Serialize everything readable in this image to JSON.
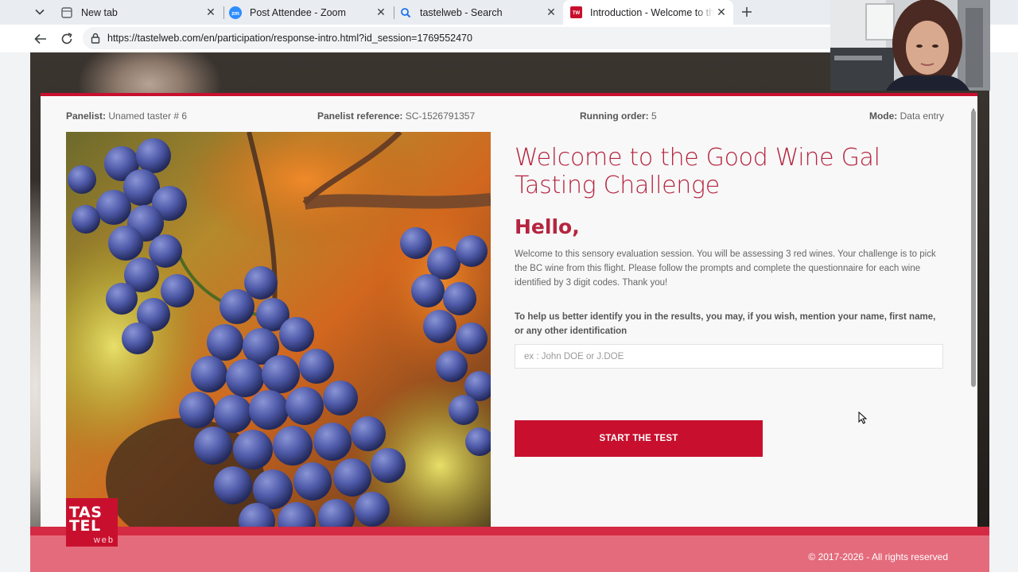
{
  "tabs": [
    {
      "title": "New tab",
      "favicon": "new-tab-page-icon"
    },
    {
      "title": "Post Attendee - Zoom",
      "favicon": "zoom-icon"
    },
    {
      "title": "tastelweb - Search",
      "favicon": "search-icon"
    },
    {
      "title": "Introduction - Welcome to the Go",
      "favicon": "tastelweb-favicon",
      "active": true
    }
  ],
  "address_bar": {
    "url": "https://tastelweb.com/en/participation/response-intro.html?id_session=1769552470"
  },
  "panel_info": {
    "panelist_label": "Panelist:",
    "panelist_value": "Unamed taster # 6",
    "reference_label": "Panelist reference:",
    "reference_value": "SC-1526791357",
    "order_label": "Running order:",
    "order_value": "5",
    "mode_label": "Mode:",
    "mode_value": "Data entry"
  },
  "content": {
    "title": "Welcome to the Good Wine Gal Tasting Challenge",
    "greeting": "Hello,",
    "intro": "Welcome to this sensory evaluation session. You will be assessing 3 red wines. Your challenge is to pick the BC wine from this flight. Please follow the prompts and complete the questionnaire for each wine identified by 3 digit codes. Thank you!",
    "identify_label": "To help us better identify you in the results, you may, if you wish, mention your name, first name, or any other identification",
    "name_placeholder": "ex : John DOE or J.DOE",
    "name_value": "",
    "start_button": "START THE TEST"
  },
  "logo": {
    "line1": "TAS",
    "line2": "TEL",
    "line3": "web"
  },
  "footer": {
    "copyright": "© 2017-2026 - All rights reserved"
  },
  "colors": {
    "brand": "#c8102e",
    "title": "#b5253f",
    "footer": "#e46b7c"
  }
}
